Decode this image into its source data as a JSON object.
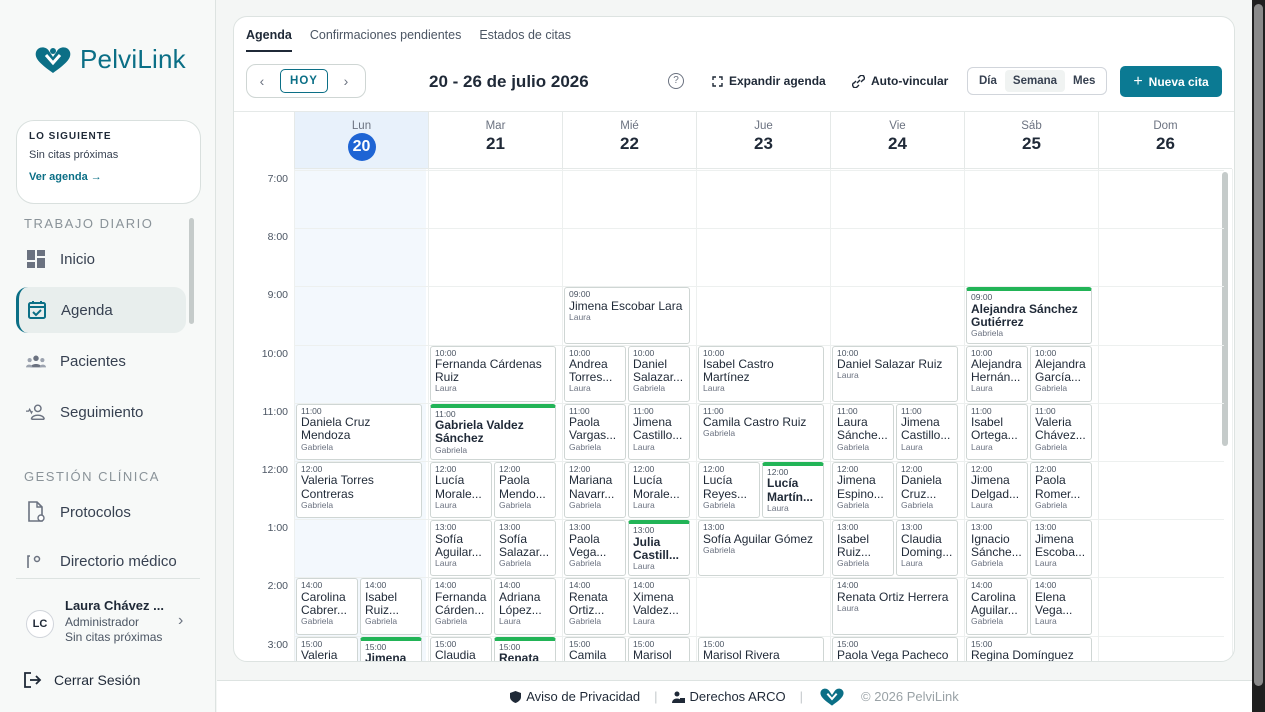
{
  "brand": {
    "name": "PelviLink"
  },
  "next_card": {
    "title": "LO SIGUIENTE",
    "subtitle": "Sin citas próximas",
    "link": "Ver agenda →"
  },
  "sidebar": {
    "section_daily": "TRABAJO DIARIO",
    "section_clinical": "GESTIÓN CLÍNICA",
    "items": [
      {
        "label": "Inicio",
        "icon": "dashboard-icon"
      },
      {
        "label": "Agenda",
        "icon": "calendar-check-icon"
      },
      {
        "label": "Pacientes",
        "icon": "patients-icon"
      },
      {
        "label": "Seguimiento",
        "icon": "follow-up-icon"
      },
      {
        "label": "Protocolos",
        "icon": "protocol-doc-icon"
      },
      {
        "label": "Directorio médico",
        "icon": "directory-icon"
      }
    ]
  },
  "user": {
    "initials": "LC",
    "name": "Laura Chávez ...",
    "role": "Administrador",
    "status": "Sin citas próximas"
  },
  "logout": {
    "label": "Cerrar Sesión"
  },
  "tabs": [
    "Agenda",
    "Confirmaciones pendientes",
    "Estados de citas"
  ],
  "toolbar": {
    "today": "HOY",
    "prev": "‹",
    "next": "›",
    "range": "20 - 26 de julio 2026",
    "help": "?",
    "expand": "Expandir agenda",
    "autolink": "Auto-vincular",
    "views": [
      "Día",
      "Semana",
      "Mes"
    ],
    "active_view": "Semana",
    "new": "Nueva cita"
  },
  "days": [
    {
      "name": "Lun",
      "num": "20",
      "today": true
    },
    {
      "name": "Mar",
      "num": "21"
    },
    {
      "name": "Mié",
      "num": "22"
    },
    {
      "name": "Jue",
      "num": "23"
    },
    {
      "name": "Vie",
      "num": "24"
    },
    {
      "name": "Sáb",
      "num": "25"
    },
    {
      "name": "Dom",
      "num": "26"
    }
  ],
  "hours": [
    "7:00",
    "8:00",
    "9:00",
    "10:00",
    "11:00",
    "12:00",
    "1:00",
    "2:00",
    "3:00"
  ],
  "events": [
    {
      "day": 2,
      "hour": 2,
      "lane": 0,
      "lanes": 1,
      "time": "09:00",
      "name": "Jimena Escobar Lara",
      "doctor": "Laura"
    },
    {
      "day": 5,
      "hour": 2,
      "lane": 0,
      "lanes": 1,
      "time": "09:00",
      "name": "Alejandra Sánchez Gutiérrez",
      "doctor": "Gabriela",
      "highlight": true,
      "wrap": true
    },
    {
      "day": 1,
      "hour": 3,
      "lane": 0,
      "lanes": 1,
      "time": "10:00",
      "name": "Fernanda Cárdenas Ruiz",
      "doctor": "Laura",
      "wrap": true
    },
    {
      "day": 2,
      "hour": 3,
      "lane": 0,
      "lanes": 2,
      "time": "10:00",
      "name": "Andrea Torres...",
      "doctor": "Laura",
      "wrap": true
    },
    {
      "day": 2,
      "hour": 3,
      "lane": 1,
      "lanes": 2,
      "time": "10:00",
      "name": "Daniel Salazar...",
      "doctor": "Gabriela",
      "wrap": true
    },
    {
      "day": 3,
      "hour": 3,
      "lane": 0,
      "lanes": 1,
      "time": "10:00",
      "name": "Isabel Castro Martínez",
      "doctor": "Laura",
      "wrap": true
    },
    {
      "day": 4,
      "hour": 3,
      "lane": 0,
      "lanes": 1,
      "time": "10:00",
      "name": "Daniel Salazar Ruiz",
      "doctor": "Laura"
    },
    {
      "day": 5,
      "hour": 3,
      "lane": 0,
      "lanes": 2,
      "time": "10:00",
      "name": "Alejandra Hernán...",
      "doctor": "Laura",
      "wrap": true
    },
    {
      "day": 5,
      "hour": 3,
      "lane": 1,
      "lanes": 2,
      "time": "10:00",
      "name": "Alejandra García...",
      "doctor": "Gabriela",
      "wrap": true
    },
    {
      "day": 0,
      "hour": 4,
      "lane": 0,
      "lanes": 1,
      "time": "11:00",
      "name": "Daniela Cruz Mendoza",
      "doctor": "Gabriela",
      "wrap": true
    },
    {
      "day": 1,
      "hour": 4,
      "lane": 0,
      "lanes": 1,
      "time": "11:00",
      "name": "Gabriela Valdez Sánchez",
      "doctor": "Gabriela",
      "highlight": true,
      "wrap": true
    },
    {
      "day": 2,
      "hour": 4,
      "lane": 0,
      "lanes": 2,
      "time": "11:00",
      "name": "Paola Vargas...",
      "doctor": "Gabriela",
      "wrap": true
    },
    {
      "day": 2,
      "hour": 4,
      "lane": 1,
      "lanes": 2,
      "time": "11:00",
      "name": "Jimena Castillo...",
      "doctor": "Laura",
      "wrap": true
    },
    {
      "day": 3,
      "hour": 4,
      "lane": 0,
      "lanes": 1,
      "time": "11:00",
      "name": "Camila Castro Ruiz",
      "doctor": "Gabriela"
    },
    {
      "day": 4,
      "hour": 4,
      "lane": 0,
      "lanes": 2,
      "time": "11:00",
      "name": "Laura Sánche...",
      "doctor": "Gabriela",
      "wrap": true
    },
    {
      "day": 4,
      "hour": 4,
      "lane": 1,
      "lanes": 2,
      "time": "11:00",
      "name": "Jimena Castillo...",
      "doctor": "Laura",
      "wrap": true
    },
    {
      "day": 5,
      "hour": 4,
      "lane": 0,
      "lanes": 2,
      "time": "11:00",
      "name": "Isabel Ortega...",
      "doctor": "Laura",
      "wrap": true
    },
    {
      "day": 5,
      "hour": 4,
      "lane": 1,
      "lanes": 2,
      "time": "11:00",
      "name": "Valeria Chávez...",
      "doctor": "Gabriela",
      "wrap": true
    },
    {
      "day": 0,
      "hour": 5,
      "lane": 0,
      "lanes": 1,
      "time": "12:00",
      "name": "Valeria Torres Contreras",
      "doctor": "Gabriela",
      "wrap": true
    },
    {
      "day": 1,
      "hour": 5,
      "lane": 0,
      "lanes": 2,
      "time": "12:00",
      "name": "Lucía Morale...",
      "doctor": "Laura",
      "wrap": true
    },
    {
      "day": 1,
      "hour": 5,
      "lane": 1,
      "lanes": 2,
      "time": "12:00",
      "name": "Paola Mendo...",
      "doctor": "Gabriela",
      "wrap": true
    },
    {
      "day": 2,
      "hour": 5,
      "lane": 0,
      "lanes": 2,
      "time": "12:00",
      "name": "Mariana Navarr...",
      "doctor": "Gabriela",
      "wrap": true
    },
    {
      "day": 2,
      "hour": 5,
      "lane": 1,
      "lanes": 2,
      "time": "12:00",
      "name": "Lucía Morale...",
      "doctor": "Laura",
      "wrap": true
    },
    {
      "day": 3,
      "hour": 5,
      "lane": 0,
      "lanes": 2,
      "time": "12:00",
      "name": "Lucía Reyes...",
      "doctor": "Gabriela",
      "wrap": true
    },
    {
      "day": 3,
      "hour": 5,
      "lane": 1,
      "lanes": 2,
      "time": "12:00",
      "name": "Lucía Martín...",
      "doctor": "Laura",
      "highlight": true,
      "wrap": true
    },
    {
      "day": 4,
      "hour": 5,
      "lane": 0,
      "lanes": 2,
      "time": "12:00",
      "name": "Jimena Espino...",
      "doctor": "Gabriela",
      "wrap": true
    },
    {
      "day": 4,
      "hour": 5,
      "lane": 1,
      "lanes": 2,
      "time": "12:00",
      "name": "Daniela Cruz...",
      "doctor": "Gabriela",
      "wrap": true
    },
    {
      "day": 5,
      "hour": 5,
      "lane": 0,
      "lanes": 2,
      "time": "12:00",
      "name": "Jimena Delgad...",
      "doctor": "Laura",
      "wrap": true
    },
    {
      "day": 5,
      "hour": 5,
      "lane": 1,
      "lanes": 2,
      "time": "12:00",
      "name": "Paola Romer...",
      "doctor": "Gabriela",
      "wrap": true
    },
    {
      "day": 1,
      "hour": 6,
      "lane": 0,
      "lanes": 2,
      "time": "13:00",
      "name": "Sofía Aguilar...",
      "doctor": "Laura",
      "wrap": true
    },
    {
      "day": 1,
      "hour": 6,
      "lane": 1,
      "lanes": 2,
      "time": "13:00",
      "name": "Sofía Salazar...",
      "doctor": "Gabriela",
      "wrap": true
    },
    {
      "day": 2,
      "hour": 6,
      "lane": 0,
      "lanes": 2,
      "time": "13:00",
      "name": "Paola Vega...",
      "doctor": "Gabriela",
      "wrap": true
    },
    {
      "day": 2,
      "hour": 6,
      "lane": 1,
      "lanes": 2,
      "time": "13:00",
      "name": "Julia Castill...",
      "doctor": "Laura",
      "highlight": true,
      "wrap": true
    },
    {
      "day": 3,
      "hour": 6,
      "lane": 0,
      "lanes": 1,
      "time": "13:00",
      "name": "Sofía Aguilar Gómez",
      "doctor": "Gabriela"
    },
    {
      "day": 4,
      "hour": 6,
      "lane": 0,
      "lanes": 2,
      "time": "13:00",
      "name": "Isabel Ruiz...",
      "doctor": "Gabriela",
      "wrap": true
    },
    {
      "day": 4,
      "hour": 6,
      "lane": 1,
      "lanes": 2,
      "time": "13:00",
      "name": "Claudia Doming...",
      "doctor": "Laura",
      "wrap": true
    },
    {
      "day": 5,
      "hour": 6,
      "lane": 0,
      "lanes": 2,
      "time": "13:00",
      "name": "Ignacio Sánche...",
      "doctor": "Gabriela",
      "wrap": true
    },
    {
      "day": 5,
      "hour": 6,
      "lane": 1,
      "lanes": 2,
      "time": "13:00",
      "name": "Jimena Escoba...",
      "doctor": "Laura",
      "wrap": true
    },
    {
      "day": 0,
      "hour": 7,
      "lane": 0,
      "lanes": 2,
      "time": "14:00",
      "name": "Carolina Cabrer...",
      "doctor": "Gabriela",
      "wrap": true
    },
    {
      "day": 0,
      "hour": 7,
      "lane": 1,
      "lanes": 2,
      "time": "14:00",
      "name": "Isabel Ruiz...",
      "doctor": "Gabriela",
      "wrap": true
    },
    {
      "day": 1,
      "hour": 7,
      "lane": 0,
      "lanes": 2,
      "time": "14:00",
      "name": "Fernanda Cárden...",
      "doctor": "Gabriela",
      "wrap": true
    },
    {
      "day": 1,
      "hour": 7,
      "lane": 1,
      "lanes": 2,
      "time": "14:00",
      "name": "Adriana López...",
      "doctor": "Laura",
      "wrap": true
    },
    {
      "day": 2,
      "hour": 7,
      "lane": 0,
      "lanes": 2,
      "time": "14:00",
      "name": "Renata Ortiz...",
      "doctor": "Gabriela",
      "wrap": true
    },
    {
      "day": 2,
      "hour": 7,
      "lane": 1,
      "lanes": 2,
      "time": "14:00",
      "name": "Ximena Valdez...",
      "doctor": "Laura",
      "wrap": true
    },
    {
      "day": 4,
      "hour": 7,
      "lane": 0,
      "lanes": 1,
      "time": "14:00",
      "name": "Renata Ortiz Herrera",
      "doctor": "Laura"
    },
    {
      "day": 5,
      "hour": 7,
      "lane": 0,
      "lanes": 2,
      "time": "14:00",
      "name": "Carolina Aguilar...",
      "doctor": "Gabriela",
      "wrap": true
    },
    {
      "day": 5,
      "hour": 7,
      "lane": 1,
      "lanes": 2,
      "time": "14:00",
      "name": "Elena Vega...",
      "doctor": "Laura",
      "wrap": true
    },
    {
      "day": 0,
      "hour": 8,
      "lane": 0,
      "lanes": 2,
      "time": "15:00",
      "name": "Valeria",
      "doctor": ""
    },
    {
      "day": 0,
      "hour": 8,
      "lane": 1,
      "lanes": 2,
      "time": "15:00",
      "name": "Jimena",
      "doctor": "",
      "highlight": true
    },
    {
      "day": 1,
      "hour": 8,
      "lane": 0,
      "lanes": 2,
      "time": "15:00",
      "name": "Claudia",
      "doctor": ""
    },
    {
      "day": 1,
      "hour": 8,
      "lane": 1,
      "lanes": 2,
      "time": "15:00",
      "name": "Renata",
      "doctor": "",
      "highlight": true
    },
    {
      "day": 2,
      "hour": 8,
      "lane": 0,
      "lanes": 2,
      "time": "15:00",
      "name": "Camila",
      "doctor": ""
    },
    {
      "day": 2,
      "hour": 8,
      "lane": 1,
      "lanes": 2,
      "time": "15:00",
      "name": "Marisol",
      "doctor": ""
    },
    {
      "day": 3,
      "hour": 8,
      "lane": 0,
      "lanes": 1,
      "time": "15:00",
      "name": "Marisol Rivera",
      "doctor": ""
    },
    {
      "day": 4,
      "hour": 8,
      "lane": 0,
      "lanes": 1,
      "time": "15:00",
      "name": "Paola Vega Pacheco",
      "doctor": ""
    },
    {
      "day": 5,
      "hour": 8,
      "lane": 0,
      "lanes": 1,
      "time": "15:00",
      "name": "Regina Domínguez",
      "doctor": ""
    }
  ],
  "footer": {
    "privacy": "Aviso de Privacidad",
    "arco": "Derechos ARCO",
    "copyright": "© 2026 PelviLink"
  },
  "colors": {
    "brand": "#0b6f86",
    "today": "#1e64d4",
    "highlight": "#22b457"
  }
}
